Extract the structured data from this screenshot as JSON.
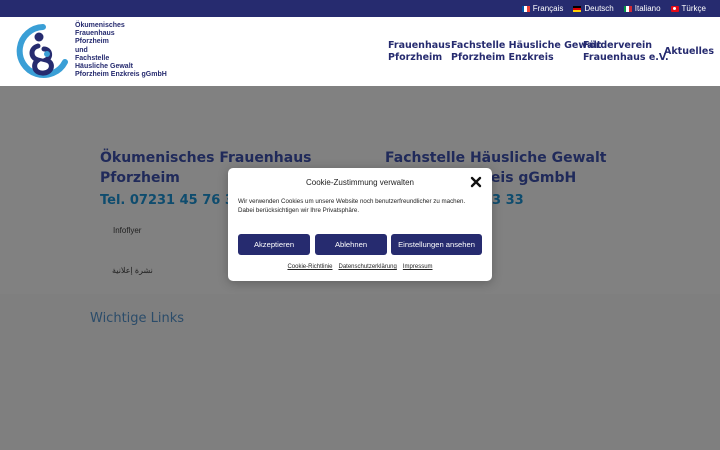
{
  "languages": [
    {
      "label": "Français",
      "icon": "flag-france-icon"
    },
    {
      "label": "Deutsch",
      "icon": "flag-germany-icon"
    },
    {
      "label": "Italiano",
      "icon": "flag-italy-icon"
    },
    {
      "label": "Türkçe",
      "icon": "flag-turkey-icon"
    }
  ],
  "logo": {
    "lines": [
      "Ökumenisches",
      "Frauenhaus",
      "Pforzheim",
      "und",
      "Fachstelle",
      "Häusliche Gewalt",
      "Pforzheim Enzkreis gGmbH"
    ]
  },
  "nav": [
    {
      "line1": "Frauenhaus",
      "line2": "Pforzheim"
    },
    {
      "line1": "Fachstelle Häusliche Gewalt",
      "line2": "Pforzheim Enzkreis"
    },
    {
      "line1": "Förderverein",
      "line2": "Frauenhaus e.V."
    },
    {
      "line1": "Aktuelles",
      "line2": ""
    }
  ],
  "hero": {
    "left": {
      "title1": "Ökumenisches Frauenhaus",
      "title2": "Pforzheim",
      "phone": "Tel. 07231 45 76 30"
    },
    "right": {
      "title1": "Fachstelle Häusliche Gewalt",
      "title2": "reis gGmbH",
      "phone": "3 33"
    },
    "links": [
      "Infoflyer",
      "نشرة إعلانية"
    ]
  },
  "lower": {
    "title": "Wichtige Links"
  },
  "cookie": {
    "title": "Cookie-Zustimmung verwalten",
    "text": "Wir verwenden Cookies um unsere Website noch benutzerfreundlicher zu machen. Dabei berücksichtigen wir Ihre Privatsphäre.",
    "accept": "Akzeptieren",
    "decline": "Ablehnen",
    "settings": "Einstellungen ansehen",
    "links": [
      "Cookie-Richtlinie",
      "Datenschutzerklärung",
      "Impressum"
    ]
  },
  "colors": {
    "brand": "#262b6f",
    "accent": "#3a9fd6",
    "hero_bg": "#818181"
  }
}
